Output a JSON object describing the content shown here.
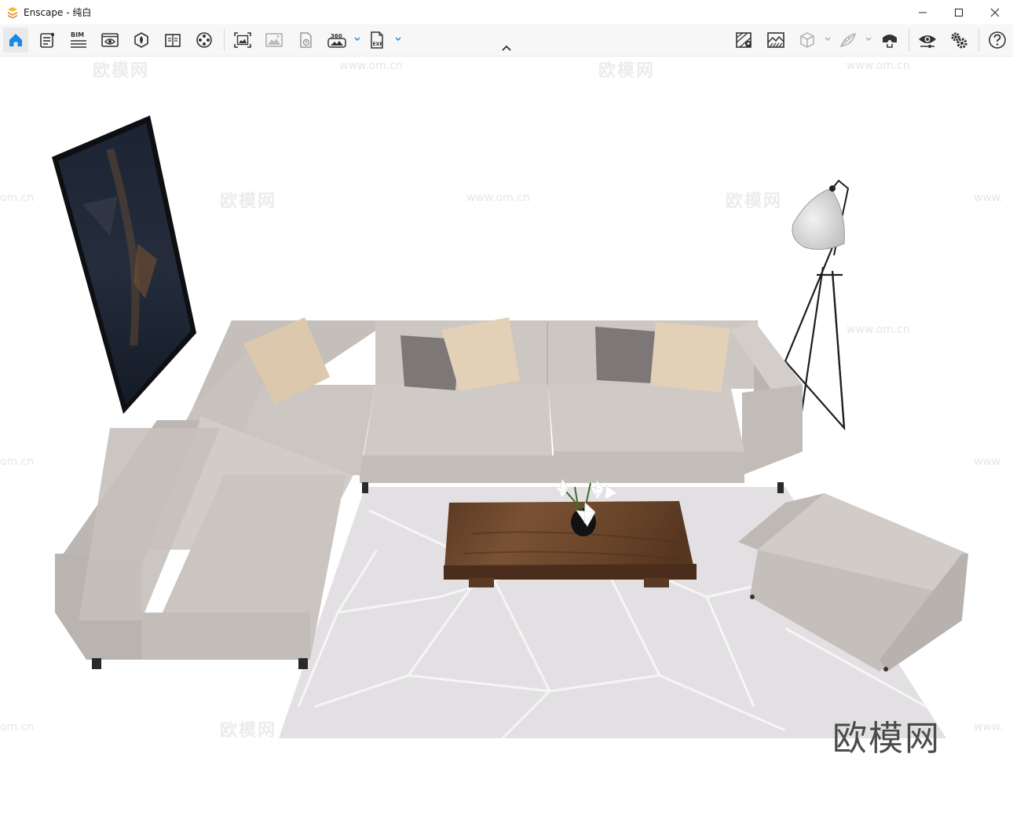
{
  "window": {
    "app_name": "Enscape",
    "separator": " - ",
    "document": "纯白",
    "controls": {
      "minimize": "minimize",
      "maximize": "maximize",
      "close": "close"
    }
  },
  "toolbar": {
    "left_tools": [
      {
        "name": "home-icon",
        "active": true
      },
      {
        "name": "notes-icon"
      },
      {
        "name": "bim-icon",
        "label": "BIM"
      },
      {
        "name": "views-icon"
      },
      {
        "name": "asset-library-icon"
      },
      {
        "name": "material-editor-icon"
      },
      {
        "name": "video-editor-icon"
      }
    ],
    "capture_tools": [
      {
        "name": "screenshot-icon"
      },
      {
        "name": "batch-render-icon"
      },
      {
        "name": "upload-icon"
      },
      {
        "name": "panorama-icon",
        "label": "360",
        "has_dropdown": true
      },
      {
        "name": "export-exe-icon",
        "label": "EXE",
        "has_dropdown": true
      }
    ],
    "right_tools": [
      {
        "name": "map-icon"
      },
      {
        "name": "atmosphere-icon"
      },
      {
        "name": "cube-icon",
        "has_dropdown": true,
        "disabled": true
      },
      {
        "name": "grass-icon",
        "has_dropdown": true,
        "disabled": true
      },
      {
        "name": "vr-headset-icon"
      },
      {
        "name": "visual-settings-icon"
      },
      {
        "name": "settings-icon"
      },
      {
        "name": "help-icon"
      }
    ]
  },
  "viewport": {
    "watermark_brand": "欧模网",
    "watermark_url": "www.om.cn",
    "watermark_url_partial": "om.cn",
    "watermark_url_cut": "www.",
    "brand_logo": "欧模网"
  },
  "colors": {
    "accent": "#1b87e6",
    "logo": "#f0a020",
    "sofa": "#c9c3c0",
    "rug": "#e4e1e3",
    "table": "#6e4a30"
  }
}
